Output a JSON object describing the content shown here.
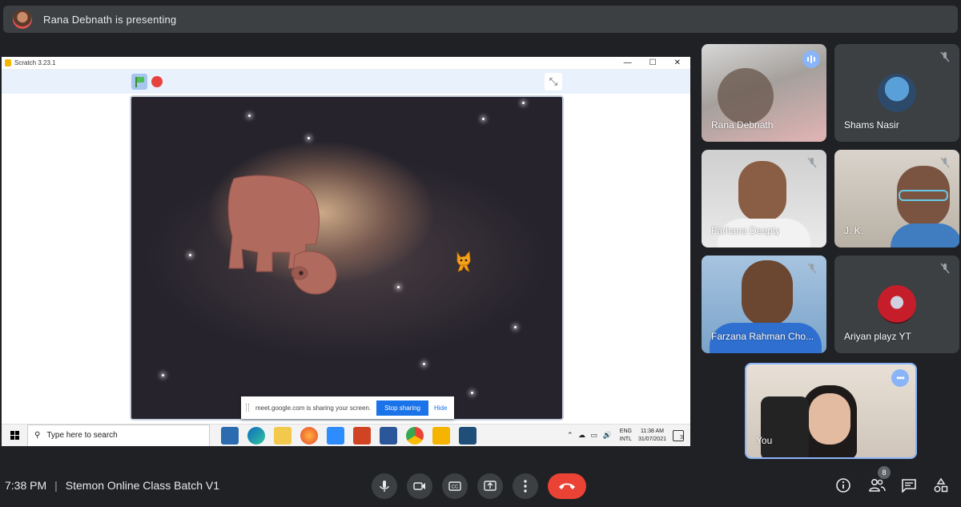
{
  "presenting_bar": {
    "text": "Rana Debnath is presenting"
  },
  "shared_screen": {
    "window_title": "Scratch 3.23.1",
    "window_controls": [
      "—",
      "☐",
      "✕"
    ],
    "share_banner": {
      "message": "meet.google.com is sharing your screen.",
      "stop_label": "Stop sharing",
      "hide_label": "Hide"
    },
    "taskbar": {
      "search_placeholder": "Type here to search",
      "language_top": "ENG",
      "language_bottom": "INTL",
      "time": "11:38 AM",
      "date": "31/07/2021",
      "notification_count": "3"
    }
  },
  "participants": [
    {
      "name": "Rana Debnath",
      "state": "speaking"
    },
    {
      "name": "Shams Nasir",
      "state": "muted"
    },
    {
      "name": "Farhana Deepty",
      "state": "muted"
    },
    {
      "name": "J. K.",
      "state": "muted"
    },
    {
      "name": "Farzana Rahman Cho...",
      "state": "muted"
    },
    {
      "name": "Ariyan playz YT",
      "state": "muted"
    },
    {
      "name": "You",
      "state": "self"
    }
  ],
  "bottom_bar": {
    "time": "7:38 PM",
    "meeting_name": "Stemon Online Class Batch V1",
    "people_count": "8"
  },
  "colors": {
    "background": "#202124",
    "tile": "#3c4043",
    "accent": "#8ab4f8",
    "end_call": "#ea4335",
    "stop_sharing": "#1a73e8"
  }
}
